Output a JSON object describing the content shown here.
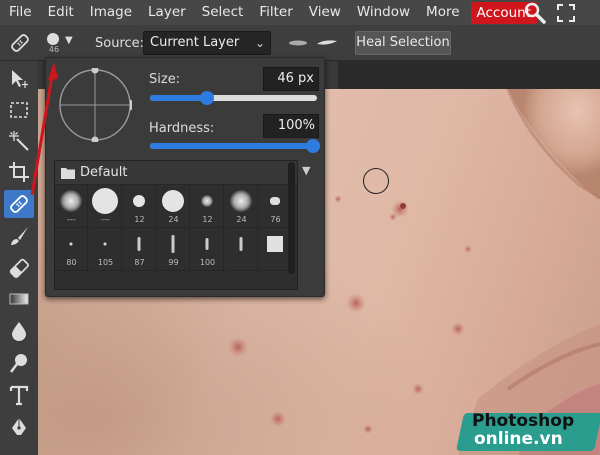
{
  "menubar": {
    "items": [
      "File",
      "Edit",
      "Image",
      "Layer",
      "Select",
      "Filter",
      "View",
      "Window",
      "More"
    ],
    "account_label": "Account",
    "search_icon": "search-icon",
    "fullscreen_icon": "fullscreen-icon"
  },
  "options": {
    "tool_icon": "healing-brush-icon",
    "brush_size_label": "46",
    "source_label": "Source:",
    "source_value": "Current Layer",
    "heal_selection_label": "Heal Selection"
  },
  "toolbar": {
    "tools": [
      {
        "name": "move-tool",
        "icon": "move-icon"
      },
      {
        "name": "marquee-tool",
        "icon": "marquee-icon"
      },
      {
        "name": "magic-wand-tool",
        "icon": "magic-wand-icon"
      },
      {
        "name": "crop-tool",
        "icon": "crop-icon"
      },
      {
        "name": "healing-brush-tool",
        "icon": "bandage-icon",
        "active": true
      },
      {
        "name": "brush-tool",
        "icon": "brush-icon"
      },
      {
        "name": "eraser-tool",
        "icon": "eraser-icon"
      },
      {
        "name": "gradient-tool",
        "icon": "gradient-icon"
      },
      {
        "name": "blur-tool",
        "icon": "drop-icon"
      },
      {
        "name": "dodge-tool",
        "icon": "dodge-icon"
      },
      {
        "name": "text-tool",
        "icon": "text-icon"
      },
      {
        "name": "pen-tool",
        "icon": "pen-icon"
      }
    ]
  },
  "brush_popup": {
    "size_label": "Size:",
    "size_value": "46",
    "size_unit": "px",
    "size_fraction": 0.34,
    "hardness_label": "Hardness:",
    "hardness_value": "100%",
    "hardness_fraction": 1.0,
    "folder_name": "Default",
    "presets": [
      {
        "label": "---",
        "kind": "soft",
        "d": 22
      },
      {
        "label": "---",
        "kind": "hard",
        "d": 26
      },
      {
        "label": "12",
        "kind": "hard",
        "d": 12
      },
      {
        "label": "24",
        "kind": "hard",
        "d": 22
      },
      {
        "label": "12",
        "kind": "soft",
        "d": 12
      },
      {
        "label": "24",
        "kind": "soft",
        "d": 22
      },
      {
        "label": "76",
        "kind": "blob",
        "d": 10
      },
      {
        "label": "80",
        "kind": "dot",
        "d": 3
      },
      {
        "label": "105",
        "kind": "dot",
        "d": 3
      },
      {
        "label": "87",
        "kind": "stroke",
        "d": 14
      },
      {
        "label": "99",
        "kind": "stroke",
        "d": 18
      },
      {
        "label": "100",
        "kind": "stroke",
        "d": 12
      },
      {
        "label": "",
        "kind": "stroke",
        "d": 14
      },
      {
        "label": "",
        "kind": "square",
        "d": 16
      }
    ]
  },
  "watermark": {
    "line1": "Photoshop",
    "line2": "online.vn"
  },
  "colors": {
    "accent": "#2e7ce0",
    "account": "#d0161d",
    "active_tool": "#3d78c9",
    "arrow": "#d0161d"
  }
}
